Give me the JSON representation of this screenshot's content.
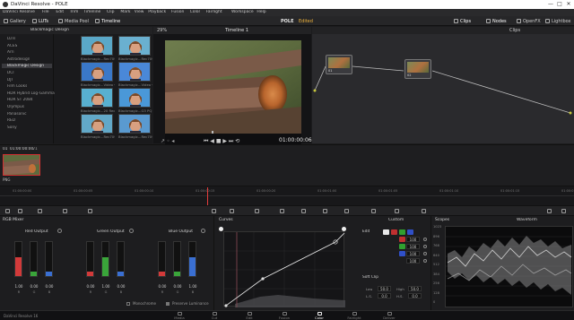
{
  "window": {
    "title": "DaVinci Resolve - POLE",
    "minimize": "—",
    "maximize": "□",
    "close": "✕"
  },
  "menubar": {
    "items": [
      "DaVinci Resolve",
      "File",
      "Edit",
      "Trim",
      "Timeline",
      "Clip",
      "Mark",
      "View",
      "Playback",
      "Fusion",
      "Color",
      "Fairlight",
      "Workspace",
      "Help"
    ]
  },
  "toolbar": {
    "gallery": "Gallery",
    "luts": "LUTs",
    "media_pool": "Media Pool",
    "timeline": "Timeline",
    "project": "POLE",
    "status": "Edited",
    "clips": "Clips",
    "nodes": "Nodes",
    "openfx": "OpenFX",
    "lightbox": "Lightbox"
  },
  "lut_panel": {
    "tree": [
      {
        "label": "LUTs",
        "selected": false
      },
      {
        "label": "ACES",
        "selected": false
      },
      {
        "label": "Arri",
        "selected": false
      },
      {
        "label": "Astrodesign",
        "selected": false
      },
      {
        "label": "Blackmagic Design",
        "selected": true
      },
      {
        "label": "DCI",
        "selected": false
      },
      {
        "label": "DJI",
        "selected": false
      },
      {
        "label": "Film Looks",
        "selected": false
      },
      {
        "label": "HDR Hybrid Log-Gamma",
        "selected": false
      },
      {
        "label": "HDR ST 2084",
        "selected": false
      },
      {
        "label": "Olympus",
        "selected": false
      },
      {
        "label": "Panasonic",
        "selected": false
      },
      {
        "label": "RED",
        "selected": false
      },
      {
        "label": "Sony",
        "selected": false
      }
    ],
    "header": "Blackmagic Design",
    "thumbs": [
      "Blackmagic...Rec709 v4",
      "Blackmagic...Rec709 v4",
      "Blackmagic...Video v4",
      "Blackmagic...Video v4",
      "Blackmagic...20 Rec709",
      "Blackmagic...G3 PQ v4",
      "Blackmagic...Rec709 v4",
      "Blackmagic...Rec709 v4"
    ]
  },
  "viewer": {
    "zoom": "29%",
    "timeline_name": "Timeline 1",
    "timecode": "01:00:00:06"
  },
  "nodes": {
    "items": [
      {
        "label": "01"
      },
      {
        "label": "02"
      }
    ]
  },
  "clips": {
    "timecode": "01:00:00:00",
    "clip_index": "01",
    "clip_label": "V1",
    "clip_name": "PNG"
  },
  "ruler": {
    "ticks": [
      "01:00:00:00",
      "01:00:00:05",
      "01:00:00:10",
      "01:00:00:15",
      "01:00:00:20",
      "01:00:01:00",
      "01:00:01:05",
      "01:00:01:10",
      "01:00:01:15",
      "01:00:01:20"
    ]
  },
  "mixer": {
    "title": "RGB Mixer",
    "outputs": [
      {
        "name": "Red Output",
        "vals": [
          "1.00",
          "0.00",
          "0.00"
        ],
        "levels": [
          0.55,
          0.12,
          0.12
        ]
      },
      {
        "name": "Green Output",
        "vals": [
          "0.00",
          "1.00",
          "0.00"
        ],
        "levels": [
          0.12,
          0.55,
          0.12
        ]
      },
      {
        "name": "Blue Output",
        "vals": [
          "0.00",
          "0.00",
          "1.00"
        ],
        "levels": [
          0.12,
          0.12,
          0.55
        ]
      }
    ],
    "channels": [
      "R",
      "G",
      "B"
    ],
    "monochrome": "Monochrome",
    "preserve_luminance": "Preserve Luminance"
  },
  "curves": {
    "title": "Curves",
    "mode": "Custom",
    "edit_label": "Edit",
    "edit_values": [
      "100",
      "100",
      "100",
      "100"
    ],
    "soft_clip": "Soft Clip",
    "low_label": "Low",
    "low": "50.0",
    "high_label": "High",
    "high": "50.0",
    "ls_label": "L.S.",
    "ls": "0.0",
    "hs_label": "H.S.",
    "hs": "0.0"
  },
  "scopes": {
    "title": "Scopes",
    "mode": "Waveform",
    "ylabels": [
      "1023",
      "896",
      "768",
      "640",
      "512",
      "384",
      "256",
      "128",
      "0"
    ]
  },
  "footer": {
    "app": "DaVinci Resolve 16"
  },
  "pagenav": {
    "items": [
      {
        "label": "Media",
        "active": false
      },
      {
        "label": "Cut",
        "active": false
      },
      {
        "label": "Edit",
        "active": false
      },
      {
        "label": "Fusion",
        "active": false
      },
      {
        "label": "Color",
        "active": true
      },
      {
        "label": "Fairlight",
        "active": false
      },
      {
        "label": "Deliver",
        "active": false
      }
    ]
  }
}
